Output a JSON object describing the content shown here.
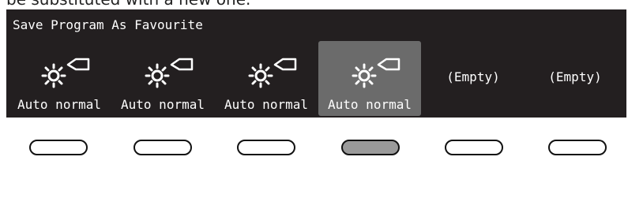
{
  "context_line": "be substituted with a new one.",
  "screen": {
    "title": "Save Program As Favourite",
    "slots": [
      {
        "label": "Auto normal",
        "icon": "sun-program-icon",
        "empty": false,
        "selected": false
      },
      {
        "label": "Auto normal",
        "icon": "sun-program-icon",
        "empty": false,
        "selected": false
      },
      {
        "label": "Auto normal",
        "icon": "sun-program-icon",
        "empty": false,
        "selected": false
      },
      {
        "label": "Auto normal",
        "icon": "sun-program-icon",
        "empty": false,
        "selected": true
      },
      {
        "label": "(Empty)",
        "empty": true,
        "selected": false
      },
      {
        "label": "(Empty)",
        "empty": true,
        "selected": false
      }
    ]
  },
  "hardware_buttons": [
    {
      "active": false
    },
    {
      "active": false
    },
    {
      "active": false
    },
    {
      "active": true
    },
    {
      "active": false
    },
    {
      "active": false
    }
  ],
  "colors": {
    "panel_bg": "#231f20",
    "selected_bg": "#6b6b6b",
    "text": "#ffffff",
    "active_button": "#9a9a9a"
  }
}
